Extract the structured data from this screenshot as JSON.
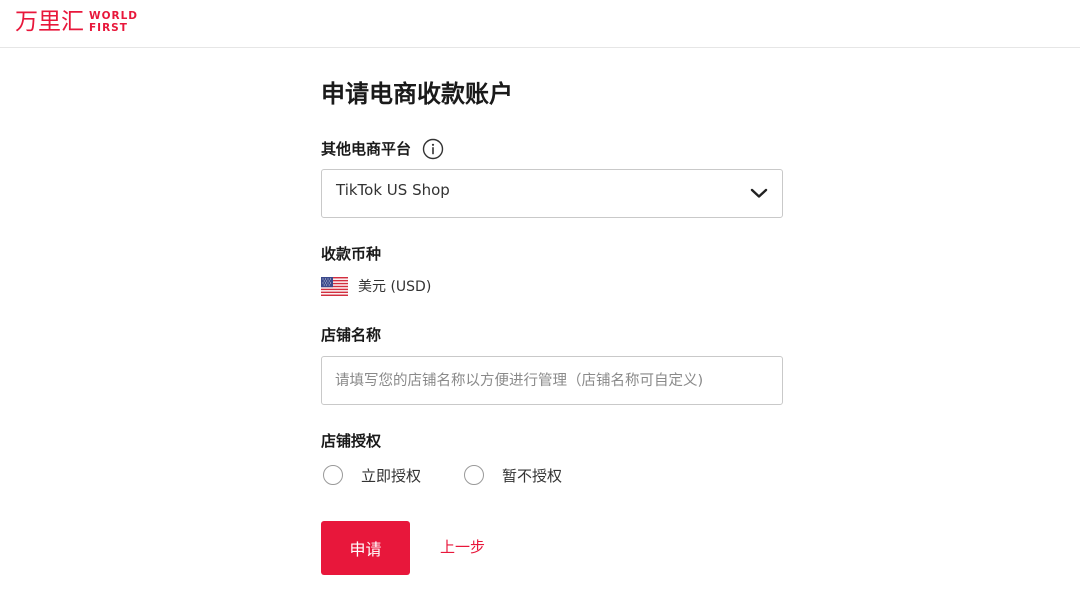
{
  "header": {
    "logo_cn": "万里汇",
    "logo_en_line1": "WORLD",
    "logo_en_line2": "FIRST"
  },
  "form": {
    "title": "申请电商收款账户",
    "platform": {
      "label": "其他电商平台",
      "selected": "TikTok US Shop",
      "info_icon": "info-icon",
      "dropdown_icon": "chevron-down-icon"
    },
    "currency": {
      "label": "收款币种",
      "value": "美元 (USD)",
      "flag_icon": "us-flag-icon"
    },
    "store_name": {
      "label": "店铺名称",
      "value": "",
      "placeholder": "请填写您的店铺名称以方便进行管理（店铺名称可自定义)"
    },
    "authorization": {
      "label": "店铺授权",
      "options": [
        "立即授权",
        "暂不授权"
      ]
    },
    "submit_label": "申请",
    "back_label": "上一步"
  },
  "colors": {
    "brand": "#e8173b",
    "border": "#c9c9c9",
    "text": "#1a1a1a"
  }
}
